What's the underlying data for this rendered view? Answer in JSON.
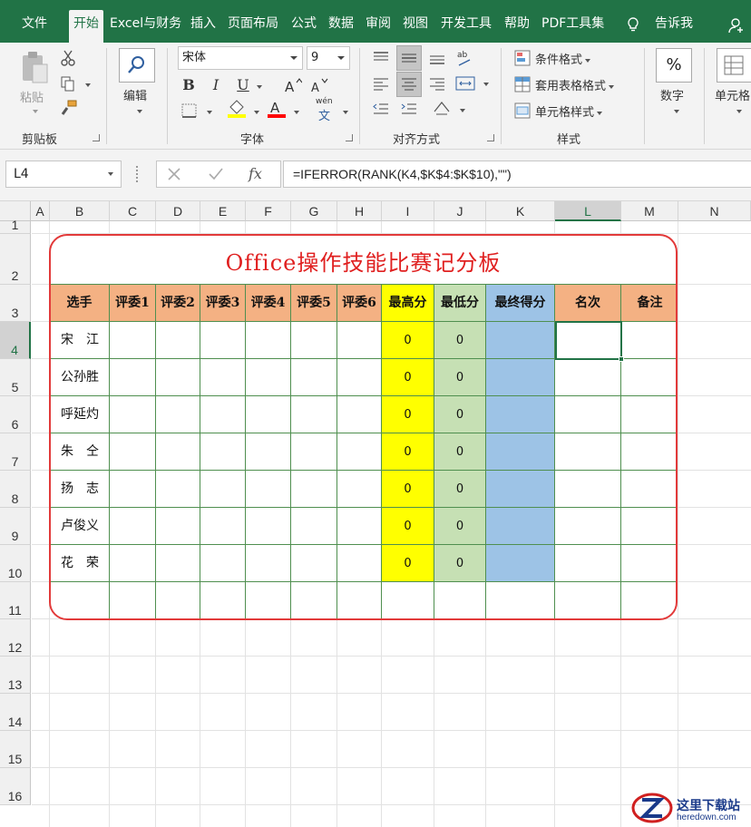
{
  "ribbon": {
    "tabs": [
      {
        "label": "文件",
        "active": false
      },
      {
        "label": "开始",
        "active": true
      },
      {
        "label": "Excel与财务",
        "active": false
      },
      {
        "label": "插入",
        "active": false
      },
      {
        "label": "页面布局",
        "active": false
      },
      {
        "label": "公式",
        "active": false
      },
      {
        "label": "数据",
        "active": false
      },
      {
        "label": "审阅",
        "active": false
      },
      {
        "label": "视图",
        "active": false
      },
      {
        "label": "开发工具",
        "active": false
      },
      {
        "label": "帮助",
        "active": false
      },
      {
        "label": "PDF工具集",
        "active": false
      }
    ],
    "tell_me": "告诉我",
    "clipboard": {
      "paste": "粘贴",
      "group": "剪贴板"
    },
    "editing": {
      "label": "编辑"
    },
    "font": {
      "name": "宋体",
      "size": "9",
      "group": "字体",
      "bold": "B",
      "italic": "I",
      "underline": "U",
      "phonetic": "wén",
      "phonetic_char": "文"
    },
    "alignment": {
      "group": "对齐方式"
    },
    "styles": {
      "conditional": "条件格式",
      "table": "套用表格格式",
      "cell": "单元格样式",
      "group": "样式"
    },
    "number": {
      "label": "数字",
      "symbol": "%"
    },
    "cells": {
      "label": "单元格"
    }
  },
  "formula_bar": {
    "name_box": "L4",
    "formula": "=IFERROR(RANK(K4,$K$4:$K$10),\"\")"
  },
  "sheet": {
    "columns": [
      "A",
      "B",
      "C",
      "D",
      "E",
      "F",
      "G",
      "H",
      "I",
      "J",
      "K",
      "L",
      "M",
      "N"
    ],
    "selected_column": "L",
    "rows": [
      "1",
      "2",
      "3",
      "4",
      "5",
      "6",
      "7",
      "8",
      "9",
      "10",
      "11",
      "12",
      "13",
      "14",
      "15",
      "16"
    ],
    "selected_row": "4"
  },
  "board": {
    "title": "Office操作技能比赛记分板",
    "headers": [
      "选手",
      "评委1",
      "评委2",
      "评委3",
      "评委4",
      "评委5",
      "评委6",
      "最高分",
      "最低分",
      "最终得分",
      "名次",
      "备注"
    ],
    "contestants": [
      {
        "name": "宋　江",
        "max": "0",
        "min": "0"
      },
      {
        "name": "公孙胜",
        "max": "0",
        "min": "0"
      },
      {
        "name": "呼延灼",
        "max": "0",
        "min": "0"
      },
      {
        "name": "朱　仝",
        "max": "0",
        "min": "0"
      },
      {
        "name": "扬　志",
        "max": "0",
        "min": "0"
      },
      {
        "name": "卢俊义",
        "max": "0",
        "min": "0"
      },
      {
        "name": "花　荣",
        "max": "0",
        "min": "0"
      }
    ]
  },
  "watermark": {
    "line1": "这里下载站",
    "line2": "heredown.com"
  },
  "colors": {
    "excel_green": "#217346",
    "header_orange": "#f4b183",
    "max_yellow": "#ffff00",
    "min_green": "#c6e0b4",
    "final_blue": "#9dc3e6",
    "board_red": "#e23a3a"
  }
}
